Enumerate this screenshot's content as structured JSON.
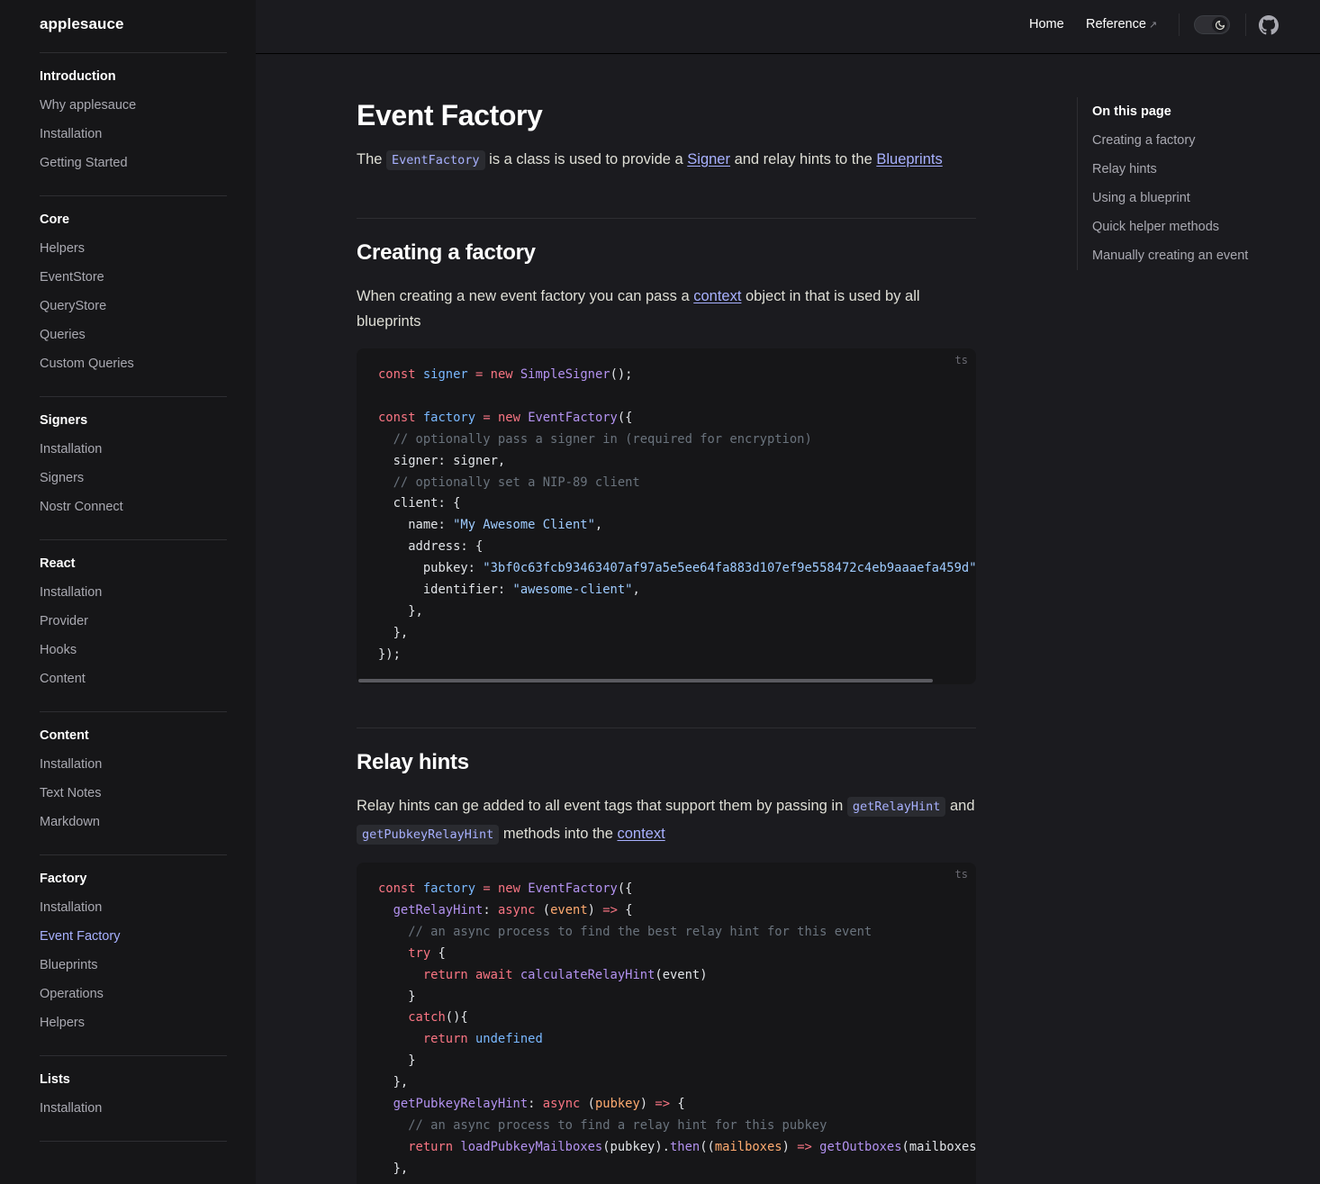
{
  "brand": "applesauce",
  "header": {
    "home_label": "Home",
    "reference_label": "Reference",
    "reference_ext": "↗"
  },
  "sidebar": {
    "groups": [
      {
        "title": "Introduction",
        "items": [
          "Why applesauce",
          "Installation",
          "Getting Started"
        ]
      },
      {
        "title": "Core",
        "items": [
          "Helpers",
          "EventStore",
          "QueryStore",
          "Queries",
          "Custom Queries"
        ]
      },
      {
        "title": "Signers",
        "items": [
          "Installation",
          "Signers",
          "Nostr Connect"
        ]
      },
      {
        "title": "React",
        "items": [
          "Installation",
          "Provider",
          "Hooks",
          "Content"
        ]
      },
      {
        "title": "Content",
        "items": [
          "Installation",
          "Text Notes",
          "Markdown"
        ]
      },
      {
        "title": "Factory",
        "items": [
          "Installation",
          "Event Factory",
          "Blueprints",
          "Operations",
          "Helpers"
        ]
      },
      {
        "title": "Lists",
        "items": [
          "Installation"
        ]
      }
    ],
    "active_item": "Event Factory"
  },
  "page": {
    "title": "Event Factory",
    "intro": {
      "t1": "The ",
      "code1": "EventFactory",
      "t2": " is a class is used to provide a ",
      "link1": "Signer",
      "t3": " and relay hints to the ",
      "link2": "Blueprints"
    },
    "section1": {
      "heading": "Creating a factory",
      "p_t1": "When creating a new event factory you can pass a ",
      "p_link": "context",
      "p_t2": " object in that is used by all blueprints",
      "code_lang": "ts"
    },
    "section2": {
      "heading": "Relay hints",
      "p_t1": "Relay hints can ge added to all event tags that support them by passing in ",
      "p_code1": "getRelayHint",
      "p_t2": " and ",
      "p_code2": "getPubkeyRelayHint",
      "p_t3": " methods into the ",
      "p_link": "context",
      "code_lang": "ts"
    }
  },
  "outline": {
    "title": "On this page",
    "items": [
      "Creating a factory",
      "Relay hints",
      "Using a blueprint",
      "Quick helper methods",
      "Manually creating an event"
    ]
  },
  "colors": {
    "background": "#1b1b1f",
    "sidebar": "#161618",
    "accent": "#a8b1ff"
  }
}
